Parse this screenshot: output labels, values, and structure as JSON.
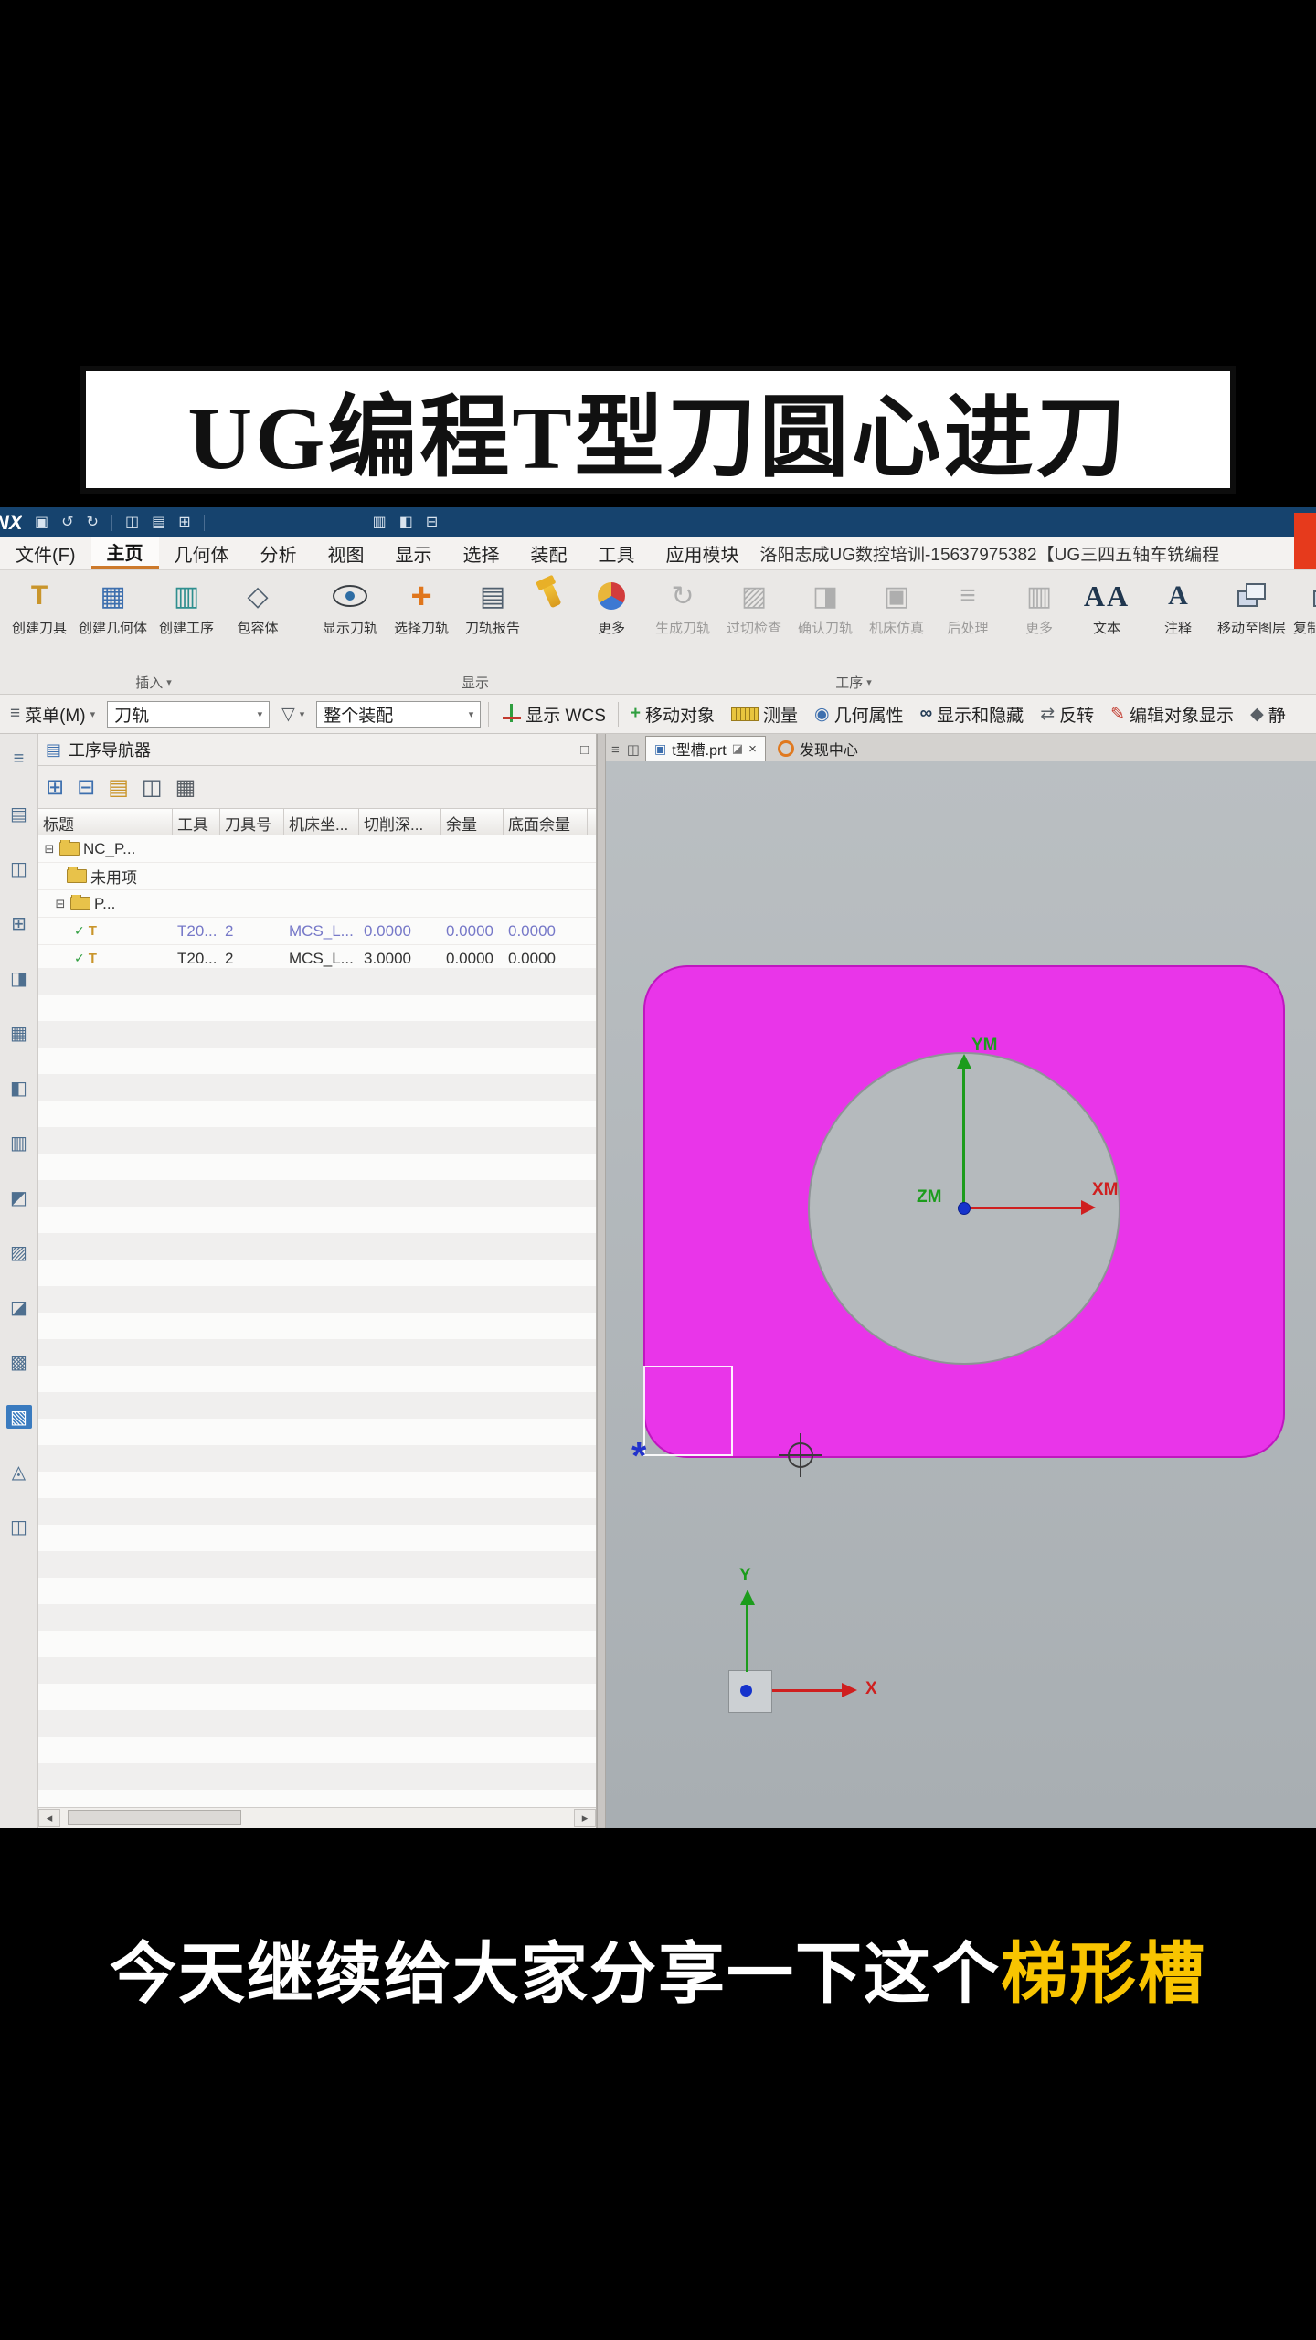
{
  "banner": {
    "title": "UG编程T型刀圆心进刀"
  },
  "titlebar": {
    "logo": "NX",
    "quick_access_icons": [
      "save-icon",
      "undo-icon",
      "redo-icon",
      "window-icon",
      "copy-icon",
      "paste-icon"
    ],
    "center_icons": [
      "touch-mode-icon",
      "window-layout-icon",
      "help-icon"
    ]
  },
  "menu": {
    "items": [
      "文件(F)",
      "主页",
      "几何体",
      "分析",
      "视图",
      "显示",
      "选择",
      "装配",
      "工具",
      "应用模块"
    ],
    "training": "洛阳志成UG数控培训-15637975382【UG三四五轴车铣编程"
  },
  "ribbon": {
    "groups": [
      {
        "label": "插入",
        "buttons": [
          "创建刀具",
          "创建几何体",
          "创建工序",
          "包容体"
        ]
      },
      {
        "label": "显示",
        "buttons": [
          "显示刀轨",
          "选择刀轨",
          "刀轨报告",
          "更多"
        ]
      },
      {
        "label": "工序",
        "buttons": [
          "生成刀轨",
          "过切检查",
          "确认刀轨",
          "机床仿真",
          "后处理",
          "更多"
        ]
      },
      {
        "label": "",
        "buttons": [
          "文本",
          "注释",
          "移动至图层",
          "复制至图层"
        ]
      }
    ]
  },
  "toolbar": {
    "menu_button": "菜单(M)",
    "path_select": "刀轨",
    "assembly_select": "整个装配",
    "items": [
      "显示 WCS",
      "移动对象",
      "测量",
      "几何属性",
      "显示和隐藏",
      "反转",
      "编辑对象显示",
      "静"
    ]
  },
  "navigator": {
    "title": "工序导航器",
    "toolbar_icons": [
      "export-icon",
      "import-icon",
      "columns-icon",
      "find-icon",
      "filter-icon"
    ],
    "columns": [
      "标题",
      "工具",
      "刀具号",
      "机床坐...",
      "切削深...",
      "余量",
      "底面余量"
    ],
    "rows": [
      {
        "label": "NC_P..."
      },
      {
        "label": "未用项"
      },
      {
        "label": "P..."
      },
      {
        "tool": "T20...",
        "tool_no": "2",
        "geometry": "MCS_L...",
        "cut_depth": "0.0000",
        "stock": "0.0000",
        "floor_stock": "0.0000"
      },
      {
        "tool": "T20...",
        "tool_no": "2",
        "geometry": "MCS_L...",
        "cut_depth": "3.0000",
        "stock": "0.0000",
        "floor_stock": "0.0000"
      }
    ]
  },
  "viewport": {
    "tabs": [
      {
        "label": "t型槽.prt"
      },
      {
        "label": "发现中心"
      }
    ],
    "axes": {
      "ym": "YM",
      "xm": "XM",
      "zm": "ZM",
      "x": "X",
      "y": "Y"
    }
  },
  "sidebar": {
    "icon_count": 15
  },
  "subtitle": {
    "white": "今天继续给大家分享一下这个",
    "yellow": "梯形槽"
  },
  "colors": {
    "part_magenta": "#e935e9",
    "axis_green": "#1c9c1c",
    "axis_red": "#cf1f1f",
    "subtitle_yellow": "#f8c400",
    "titlebar_blue": "#16436e"
  }
}
